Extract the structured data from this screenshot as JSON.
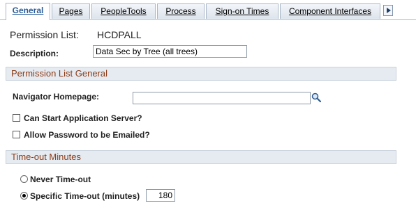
{
  "tabs": [
    {
      "label": "General",
      "active": true
    },
    {
      "label": "Pages",
      "active": false
    },
    {
      "label": "PeopleTools",
      "active": false
    },
    {
      "label": "Process",
      "active": false
    },
    {
      "label": "Sign-on Times",
      "active": false
    },
    {
      "label": "Component Interfaces",
      "active": false
    }
  ],
  "permission_list": {
    "label": "Permission List:",
    "value": "HCDPALL"
  },
  "description": {
    "label": "Description:",
    "value": "Data Sec by Tree (all trees)"
  },
  "section_general": {
    "title": "Permission List General",
    "navigator_label": "Navigator Homepage:",
    "navigator_value": "",
    "can_start_label": "Can Start Application Server?",
    "can_start_checked": false,
    "allow_pw_label": "Allow Password to be Emailed?",
    "allow_pw_checked": false
  },
  "section_timeout": {
    "title": "Time-out Minutes",
    "never_label": "Never Time-out",
    "specific_label": "Specific Time-out (minutes)",
    "selected": "specific",
    "minutes_value": "180"
  },
  "icons": {
    "lookup": "magnifier-icon",
    "next_tab": "arrow-right-icon"
  },
  "colors": {
    "tab_active_text": "#2a5c99",
    "section_title": "#8b3b16",
    "section_bg": "#e6ebf1"
  }
}
